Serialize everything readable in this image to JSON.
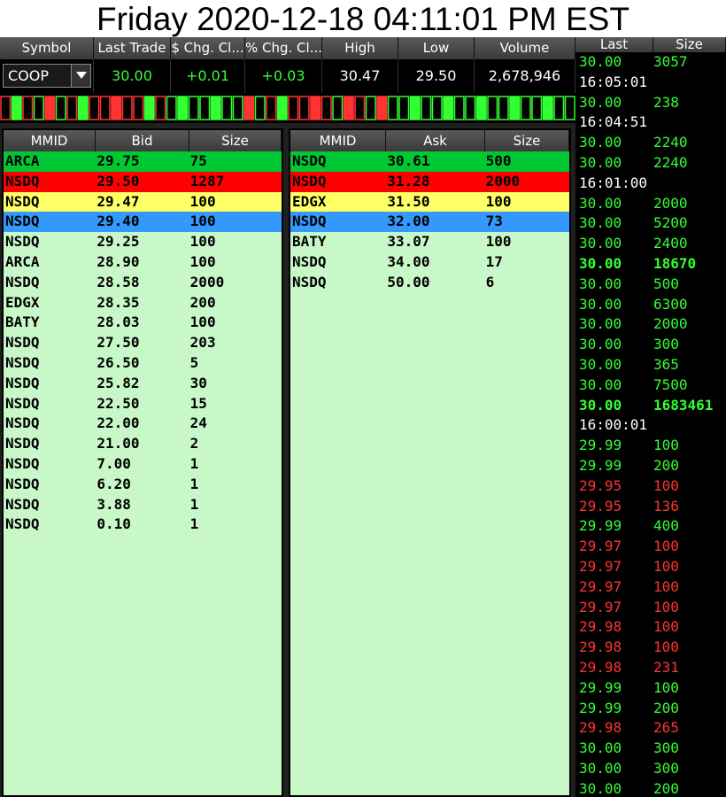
{
  "title": "Friday 2020-12-18 04:11:01 PM EST",
  "colors": {
    "green_row": "#00c832",
    "red_row": "#ff0000",
    "yellow_row": "#ffff66",
    "blue_row": "#3399ff",
    "book_bg": "#c8f8c8",
    "tas_green": "#33ff33",
    "tas_red": "#ff3333"
  },
  "quote": {
    "headers": [
      "Symbol",
      "Last Trade",
      "$ Chg. Cl...",
      "% Chg. Cl...",
      "High",
      "Low",
      "Volume"
    ],
    "symbol": "COOP",
    "last": "30.00",
    "chg": "+0.01",
    "pct": "+0.03",
    "high": "30.47",
    "low": "29.50",
    "volume": "2,678,946"
  },
  "tickbar": [
    "r",
    "g",
    "r",
    "g",
    "r",
    "g",
    "r",
    "g",
    "r",
    "r",
    "r",
    "r",
    "r",
    "g",
    "r",
    "g",
    "g",
    "g",
    "g",
    "g",
    "g",
    "g",
    "r",
    "g",
    "r",
    "g",
    "r",
    "r",
    "r",
    "r",
    "g",
    "r",
    "r",
    "g",
    "r",
    "g",
    "g",
    "g",
    "g",
    "g",
    "g",
    "g",
    "g",
    "g",
    "g",
    "g",
    "g",
    "g",
    "g",
    "g",
    "g",
    "g"
  ],
  "bid_book": {
    "headers": [
      "MMID",
      "Bid",
      "Size"
    ],
    "rows": [
      {
        "mmid": "ARCA",
        "price": "29.75",
        "size": "75",
        "tier": "green"
      },
      {
        "mmid": "NSDQ",
        "price": "29.50",
        "size": "1287",
        "tier": "red"
      },
      {
        "mmid": "NSDQ",
        "price": "29.47",
        "size": "100",
        "tier": "yellow"
      },
      {
        "mmid": "NSDQ",
        "price": "29.40",
        "size": "100",
        "tier": "blue"
      },
      {
        "mmid": "NSDQ",
        "price": "29.25",
        "size": "100",
        "tier": ""
      },
      {
        "mmid": "ARCA",
        "price": "28.90",
        "size": "100",
        "tier": ""
      },
      {
        "mmid": "NSDQ",
        "price": "28.58",
        "size": "2000",
        "tier": ""
      },
      {
        "mmid": "EDGX",
        "price": "28.35",
        "size": "200",
        "tier": ""
      },
      {
        "mmid": "BATY",
        "price": "28.03",
        "size": "100",
        "tier": ""
      },
      {
        "mmid": "NSDQ",
        "price": "27.50",
        "size": "203",
        "tier": ""
      },
      {
        "mmid": "NSDQ",
        "price": "26.50",
        "size": "5",
        "tier": ""
      },
      {
        "mmid": "NSDQ",
        "price": "25.82",
        "size": "30",
        "tier": ""
      },
      {
        "mmid": "NSDQ",
        "price": "22.50",
        "size": "15",
        "tier": ""
      },
      {
        "mmid": "NSDQ",
        "price": "22.00",
        "size": "24",
        "tier": ""
      },
      {
        "mmid": "NSDQ",
        "price": "21.00",
        "size": "2",
        "tier": ""
      },
      {
        "mmid": "NSDQ",
        "price": "7.00",
        "size": "1",
        "tier": ""
      },
      {
        "mmid": "NSDQ",
        "price": "6.20",
        "size": "1",
        "tier": ""
      },
      {
        "mmid": "NSDQ",
        "price": "3.88",
        "size": "1",
        "tier": ""
      },
      {
        "mmid": "NSDQ",
        "price": "0.10",
        "size": "1",
        "tier": ""
      }
    ]
  },
  "ask_book": {
    "headers": [
      "MMID",
      "Ask",
      "Size"
    ],
    "rows": [
      {
        "mmid": "NSDQ",
        "price": "30.61",
        "size": "500",
        "tier": "green"
      },
      {
        "mmid": "NSDQ",
        "price": "31.28",
        "size": "2000",
        "tier": "red"
      },
      {
        "mmid": "EDGX",
        "price": "31.50",
        "size": "100",
        "tier": "yellow"
      },
      {
        "mmid": "NSDQ",
        "price": "32.00",
        "size": "73",
        "tier": "blue"
      },
      {
        "mmid": "BATY",
        "price": "33.07",
        "size": "100",
        "tier": ""
      },
      {
        "mmid": "NSDQ",
        "price": "34.00",
        "size": "17",
        "tier": ""
      },
      {
        "mmid": "NSDQ",
        "price": "50.00",
        "size": "6",
        "tier": ""
      }
    ]
  },
  "tas": {
    "headers": [
      "Last",
      "Size"
    ],
    "rows": [
      {
        "price": "30.00",
        "size": "3057",
        "color": "green"
      },
      {
        "time": "16:05:01"
      },
      {
        "price": "30.00",
        "size": "238",
        "color": "green"
      },
      {
        "time": "16:04:51"
      },
      {
        "price": "30.00",
        "size": "2240",
        "color": "green"
      },
      {
        "price": "30.00",
        "size": "2240",
        "color": "green"
      },
      {
        "time": "16:01:00"
      },
      {
        "price": "30.00",
        "size": "2000",
        "color": "green"
      },
      {
        "price": "30.00",
        "size": "5200",
        "color": "green"
      },
      {
        "price": "30.00",
        "size": "2400",
        "color": "green"
      },
      {
        "price": "30.00",
        "size": "18670",
        "color": "green",
        "bold": true
      },
      {
        "price": "30.00",
        "size": "500",
        "color": "green"
      },
      {
        "price": "30.00",
        "size": "6300",
        "color": "green"
      },
      {
        "price": "30.00",
        "size": "2000",
        "color": "green"
      },
      {
        "price": "30.00",
        "size": "300",
        "color": "green"
      },
      {
        "price": "30.00",
        "size": "365",
        "color": "green"
      },
      {
        "price": "30.00",
        "size": "7500",
        "color": "green"
      },
      {
        "price": "30.00",
        "size": "1683461",
        "color": "green",
        "bold": true
      },
      {
        "time": "16:00:01"
      },
      {
        "price": "29.99",
        "size": "100",
        "color": "green"
      },
      {
        "price": "29.99",
        "size": "200",
        "color": "green"
      },
      {
        "price": "29.95",
        "size": "100",
        "color": "red"
      },
      {
        "price": "29.95",
        "size": "136",
        "color": "red"
      },
      {
        "price": "29.99",
        "size": "400",
        "color": "green"
      },
      {
        "price": "29.97",
        "size": "100",
        "color": "red"
      },
      {
        "price": "29.97",
        "size": "100",
        "color": "red"
      },
      {
        "price": "29.97",
        "size": "100",
        "color": "red"
      },
      {
        "price": "29.97",
        "size": "100",
        "color": "red"
      },
      {
        "price": "29.98",
        "size": "100",
        "color": "red"
      },
      {
        "price": "29.98",
        "size": "100",
        "color": "red"
      },
      {
        "price": "29.98",
        "size": "231",
        "color": "red"
      },
      {
        "price": "29.99",
        "size": "100",
        "color": "green"
      },
      {
        "price": "29.99",
        "size": "200",
        "color": "green"
      },
      {
        "price": "29.98",
        "size": "265",
        "color": "red"
      },
      {
        "price": "30.00",
        "size": "300",
        "color": "green"
      },
      {
        "price": "30.00",
        "size": "300",
        "color": "green"
      },
      {
        "price": "30.00",
        "size": "200",
        "color": "green"
      }
    ]
  }
}
